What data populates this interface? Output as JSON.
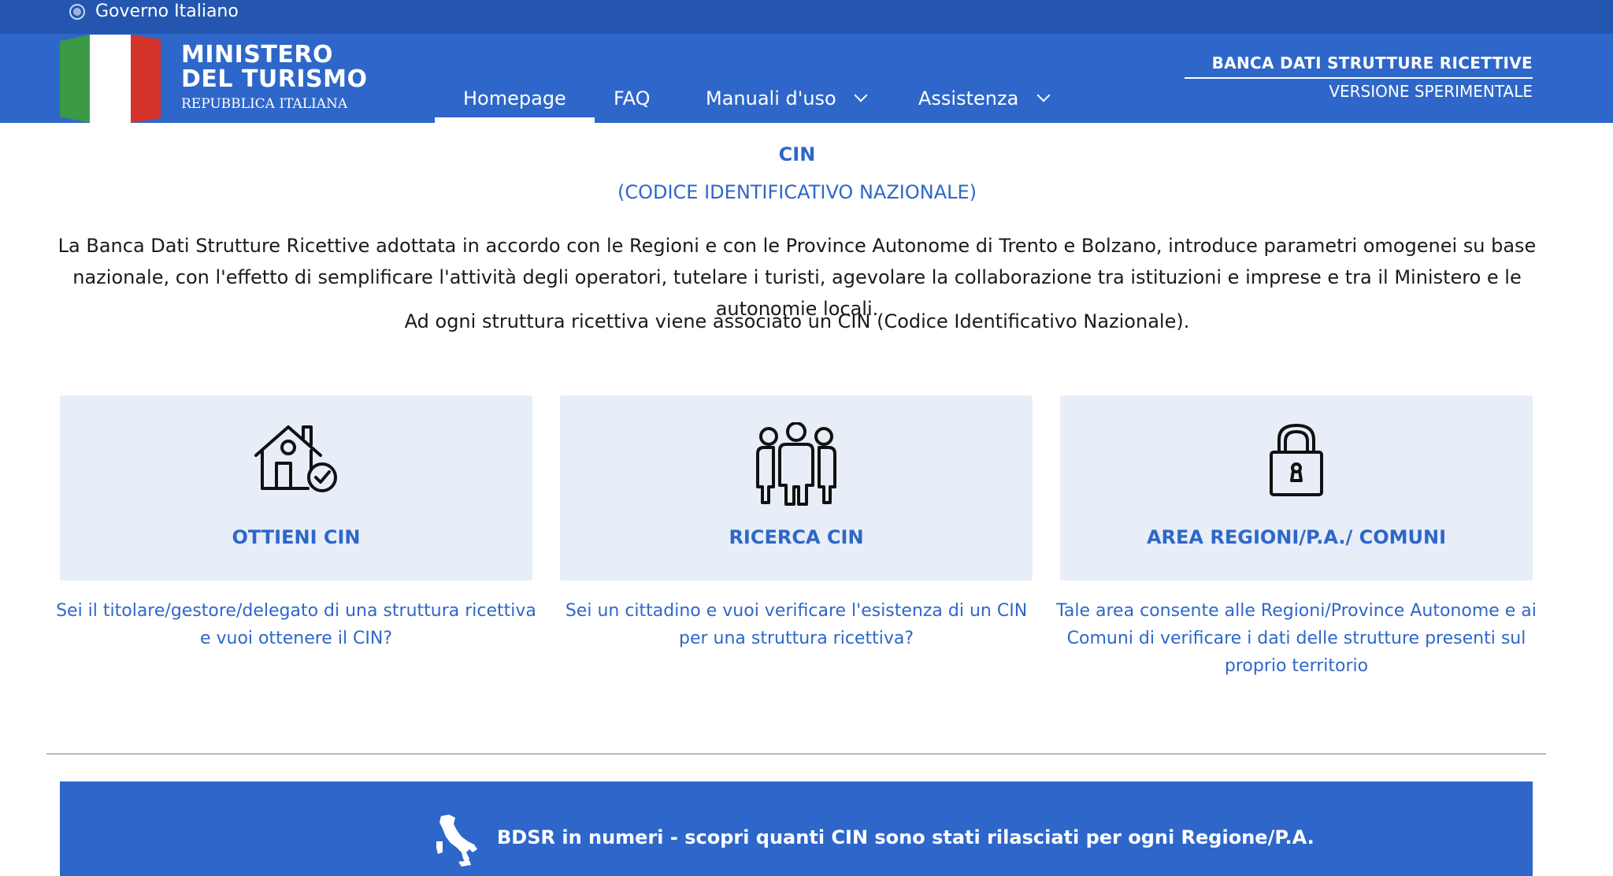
{
  "topbar": {
    "gov_label": "Governo Italiano"
  },
  "brand": {
    "line1": "MINISTERO",
    "line2": "DEL TURISMO",
    "line3": "REPUBBLICA ITALIANA"
  },
  "nav": {
    "items": [
      {
        "label": "Homepage",
        "active": true
      },
      {
        "label": "FAQ"
      },
      {
        "label": "Manuali d'uso"
      },
      {
        "label": "Assistenza"
      }
    ]
  },
  "header_right": {
    "title": "BANCA DATI STRUTTURE RICETTIVE",
    "subtitle": "VERSIONE SPERIMENTALE"
  },
  "main": {
    "title": "CIN",
    "subtitle": "(CODICE IDENTIFICATIVO NAZIONALE)",
    "intro": "La Banca Dati Strutture Ricettive adottata in accordo con le Regioni e con le Province Autonome di Trento e Bolzano, introduce parametri omogenei su base nazionale, con l'effetto di semplificare l'attività degli operatori, tutelare i turisti, agevolare la collaborazione tra istituzioni e imprese e tra il Ministero e le autonomie locali.",
    "intro2": "Ad ogni struttura ricettiva viene associato un CIN (Codice Identificativo Nazionale)."
  },
  "cards": [
    {
      "label": "OTTIENI CIN",
      "icon": "house-check-icon",
      "description": "Sei il titolare/gestore/delegato di una struttura ricettiva e vuoi ottenere il CIN?"
    },
    {
      "label": "RICERCA CIN",
      "icon": "people-group-icon",
      "description": "Sei un cittadino e vuoi verificare l'esistenza di un CIN per una struttura ricettiva?"
    },
    {
      "label": "AREA REGIONI/P.A./ COMUNI",
      "icon": "padlock-icon",
      "description": "Tale area consente alle Regioni/Province Autonome e ai Comuni di verificare i dati delle strutture presenti sul proprio territorio"
    }
  ],
  "banner": {
    "text": "BDSR in numeri - scopri quanti CIN sono stati rilasciati per ogni Regione/P.A.",
    "icon": "italy-map-icon"
  },
  "colors": {
    "primary": "#2e67c9",
    "topbar": "#2456b0",
    "card_bg": "#e8eef7",
    "flag_green": "#3a9a45",
    "flag_red": "#d4342c"
  }
}
